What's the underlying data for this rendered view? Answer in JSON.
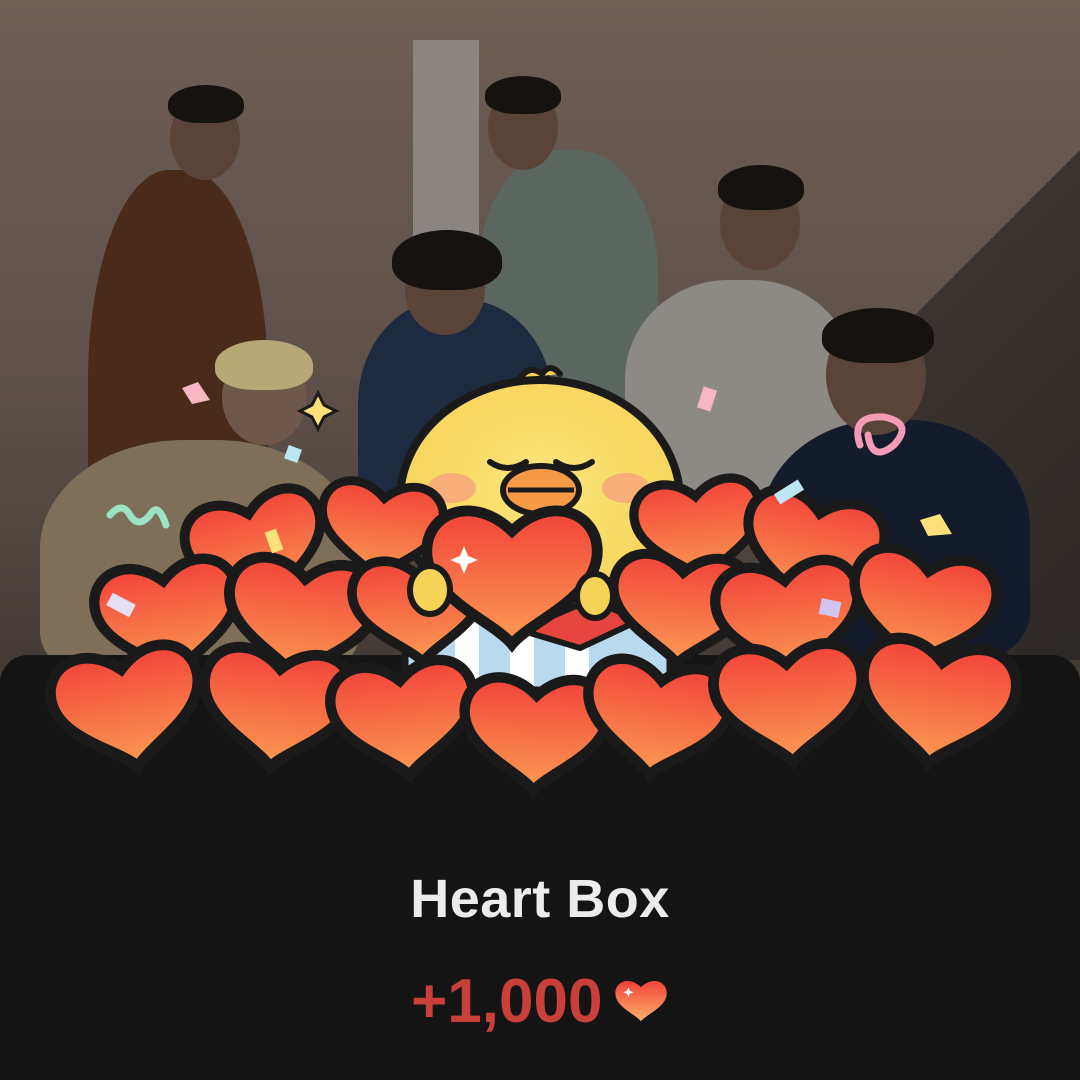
{
  "reward_popup": {
    "title": "Heart Box",
    "amount": "+1,000"
  },
  "icons": {
    "currency": "heart-icon",
    "mascot": "chick-character"
  },
  "colors": {
    "sheet_background": "#141414",
    "title_text": "#ececec",
    "amount_text": "#c9403a",
    "heart_gradient_top": "#f2433a",
    "heart_gradient_bottom": "#fb9b52"
  }
}
